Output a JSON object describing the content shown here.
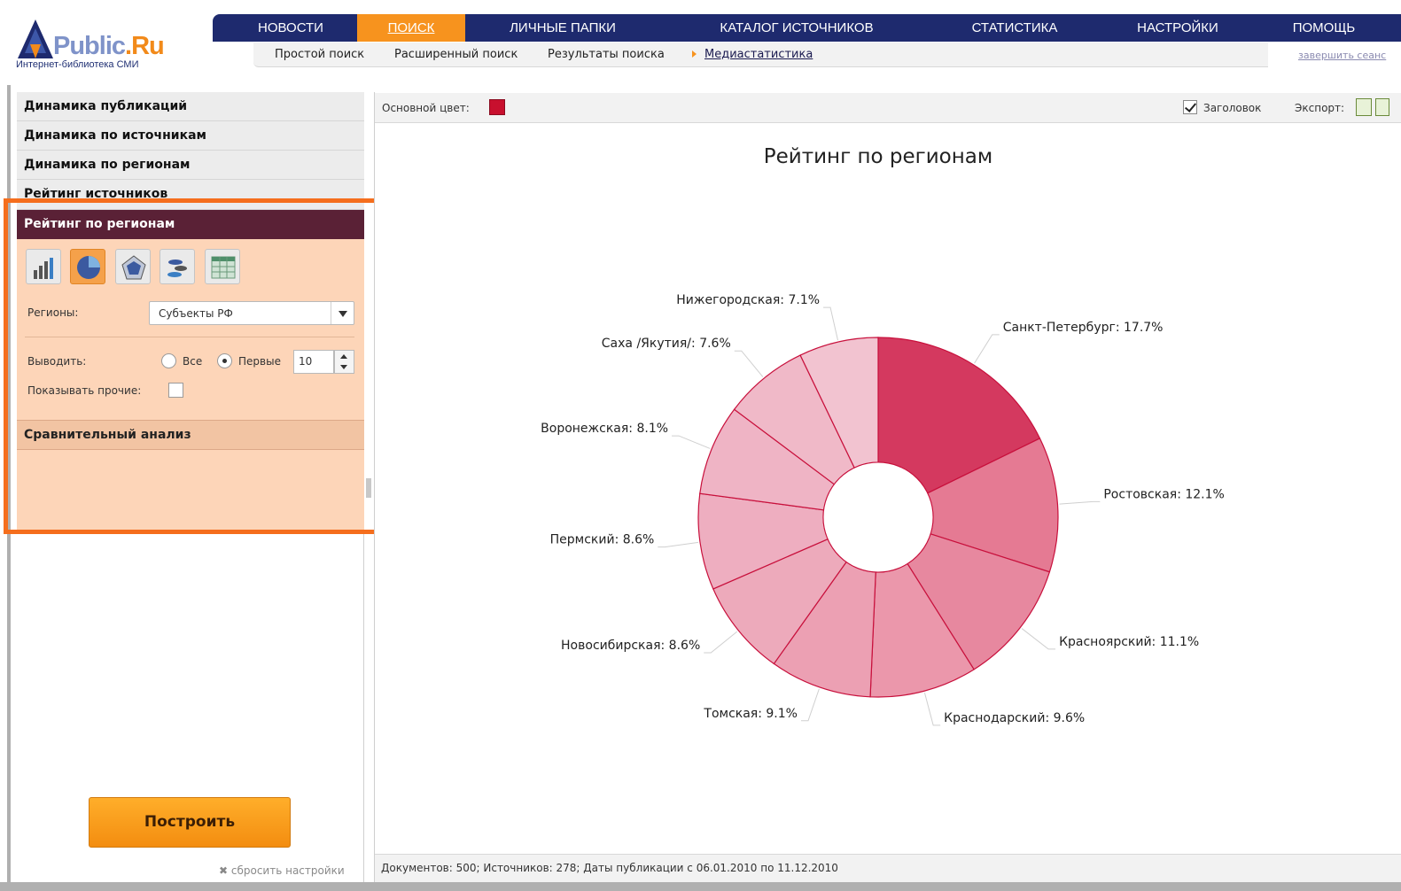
{
  "logo": {
    "brand_main": "Public",
    "brand_suffix": ".Ru",
    "tagline": "Интернет-библиотека СМИ"
  },
  "nav": {
    "items": [
      {
        "label": "НОВОСТИ"
      },
      {
        "label": "ПОИСК",
        "active": true
      },
      {
        "label": "ЛИЧНЫЕ ПАПКИ"
      },
      {
        "label": "КАТАЛОГ ИСТОЧНИКОВ"
      },
      {
        "label": "СТАТИСТИКА"
      },
      {
        "label": "НАСТРОЙКИ"
      },
      {
        "label": "ПОМОЩЬ"
      }
    ]
  },
  "subnav": {
    "items": [
      {
        "label": "Простой поиск"
      },
      {
        "label": "Расширенный поиск"
      },
      {
        "label": "Результаты поиска"
      },
      {
        "label": "Медиастатистика",
        "current": true
      }
    ],
    "logout": "завершить сеанс"
  },
  "sidebar": {
    "sections": [
      {
        "label": "Динамика публикаций"
      },
      {
        "label": "Динамика по источникам"
      },
      {
        "label": "Динамика по регионам"
      },
      {
        "label": "Рейтинг источников"
      },
      {
        "label": "Рейтинг по регионам",
        "active": true
      }
    ],
    "chart_types": [
      {
        "icon": "bar-chart-icon"
      },
      {
        "icon": "pie-chart-icon",
        "selected": true
      },
      {
        "icon": "radar-chart-icon"
      },
      {
        "icon": "bubble-chart-icon"
      },
      {
        "icon": "table-icon"
      }
    ],
    "regions_label": "Регионы:",
    "regions_value": "Субъекты РФ",
    "output_label": "Выводить:",
    "output_all": "Все",
    "output_first": "Первые",
    "output_count": "10",
    "show_other_label": "Показывать прочие:",
    "compare_label": "Сравнительный анализ",
    "build_button": "Построить",
    "reset_link": "сбросить настройки"
  },
  "toolbar": {
    "main_color_label": "Основной цвет:",
    "main_color": "#c8102e",
    "title_label": "Заголовок",
    "export_label": "Экспорт:"
  },
  "chart_data": {
    "type": "pie",
    "title": "Рейтинг по регионам",
    "slices": [
      {
        "label": "Санкт-Петербург",
        "value": 17.7,
        "display": "Санкт-Петербург: 17.7%"
      },
      {
        "label": "Ростовская",
        "value": 12.1,
        "display": "Ростовская: 12.1%"
      },
      {
        "label": "Красноярский",
        "value": 11.1,
        "display": "Красноярский: 11.1%"
      },
      {
        "label": "Краснодарский",
        "value": 9.6,
        "display": "Краснодарский: 9.6%"
      },
      {
        "label": "Томская",
        "value": 9.1,
        "display": "Томская: 9.1%"
      },
      {
        "label": "Новосибирская",
        "value": 8.6,
        "display": "Новосибирская: 8.6%"
      },
      {
        "label": "Пермский",
        "value": 8.6,
        "display": "Пермский: 8.6%"
      },
      {
        "label": "Воронежская",
        "value": 8.1,
        "display": "Воронежская: 8.1%"
      },
      {
        "label": "Саха /Якутия/",
        "value": 7.6,
        "display": "Саха /Якутия/: 7.6%"
      },
      {
        "label": "Нижегородская",
        "value": 7.1,
        "display": "Нижегородская: 7.1%"
      }
    ],
    "colors": [
      "#d4395f",
      "#e57a93",
      "#e7889f",
      "#eb97ab",
      "#eca0b3",
      "#edaabb",
      "#eeaec0",
      "#efb4c5",
      "#f0b9c8",
      "#f2c3d0"
    ],
    "donut": true
  },
  "status": "Документов: 500; Источников: 278; Даты публикации с 06.01.2010 по 11.12.2010"
}
